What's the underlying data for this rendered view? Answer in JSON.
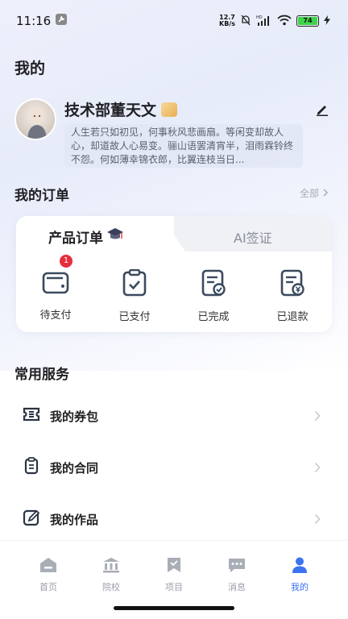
{
  "status_bar": {
    "time": "11:16",
    "net_speed_value": "12.7",
    "net_speed_unit": "KB/s",
    "battery": "74"
  },
  "page": {
    "title": "我的"
  },
  "profile": {
    "name": "技术部董天文",
    "bio": "人生若只如初见，何事秋风悲画扇。等闲变却故人心，却道故人心易变。骊山语罢清宵半，泪雨霖铃终不怨。何如薄幸锦衣郎，比翼连枝当日..."
  },
  "orders": {
    "title": "我的订单",
    "all_label": "全部",
    "tabs": [
      {
        "label": "产品订单"
      },
      {
        "label": "AI签证"
      }
    ],
    "items": [
      {
        "label": "待支付",
        "badge": "1"
      },
      {
        "label": "已支付"
      },
      {
        "label": "已完成"
      },
      {
        "label": "已退款"
      }
    ]
  },
  "services": {
    "title": "常用服务",
    "items": [
      {
        "label": "我的券包",
        "icon": "coupon-icon"
      },
      {
        "label": "我的合同",
        "icon": "contract-icon"
      },
      {
        "label": "我的作品",
        "icon": "works-icon"
      }
    ]
  },
  "nav": {
    "items": [
      {
        "label": "首页",
        "icon": "home-icon"
      },
      {
        "label": "院校",
        "icon": "school-icon"
      },
      {
        "label": "项目",
        "icon": "bookmark-icon"
      },
      {
        "label": "消息",
        "icon": "message-icon"
      },
      {
        "label": "我的",
        "icon": "user-icon",
        "active": true
      }
    ]
  },
  "colors": {
    "accent": "#3b73f1",
    "badge_red": "#e62e3d",
    "battery_green": "#3ed44a"
  }
}
